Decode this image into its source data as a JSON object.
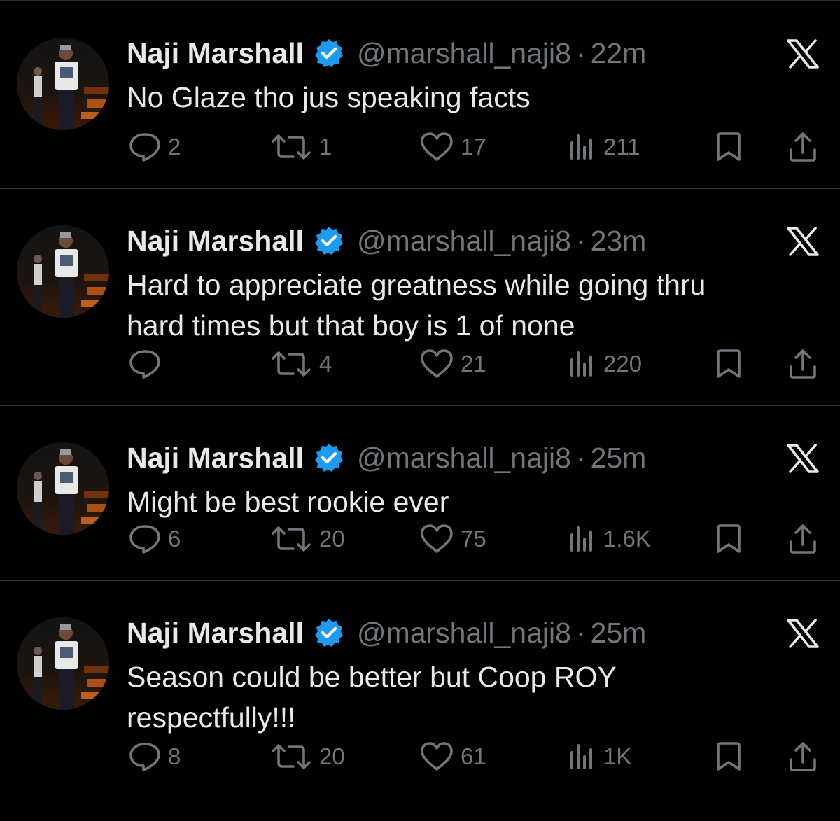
{
  "tweets": [
    {
      "name": "Naji Marshall",
      "handle": "@marshall_naji8",
      "time": "22m",
      "text_lines": [
        "No Glaze tho jus speaking facts"
      ],
      "replies": "2",
      "retweets": "1",
      "likes": "17",
      "views": "211"
    },
    {
      "name": "Naji Marshall",
      "handle": "@marshall_naji8",
      "time": "23m",
      "text_lines": [
        "Hard to appreciate greatness while going thru",
        "hard times but that boy is 1 of none"
      ],
      "replies": "",
      "retweets": "4",
      "likes": "21",
      "views": "220"
    },
    {
      "name": "Naji Marshall",
      "handle": "@marshall_naji8",
      "time": "25m",
      "text_lines": [
        "Might be best rookie ever"
      ],
      "replies": "6",
      "retweets": "20",
      "likes": "75",
      "views": "1.6K"
    },
    {
      "name": "Naji Marshall",
      "handle": "@marshall_naji8",
      "time": "25m",
      "text_lines": [
        "Season could be better but Coop ROY",
        "respectfully!!!"
      ],
      "replies": "8",
      "retweets": "20",
      "likes": "61",
      "views": "1K"
    }
  ],
  "separator": "·",
  "icons": {
    "verified": "verified-badge-icon",
    "x_logo": "x-logo-icon",
    "reply": "reply-icon",
    "retweet": "retweet-icon",
    "like": "heart-icon",
    "views": "views-icon",
    "bookmark": "bookmark-icon",
    "share": "share-icon"
  },
  "colors": {
    "background": "#000000",
    "text": "#e7e9ea",
    "muted": "#71767b",
    "verified": "#1d9bf0",
    "divider": "#2f3336"
  }
}
